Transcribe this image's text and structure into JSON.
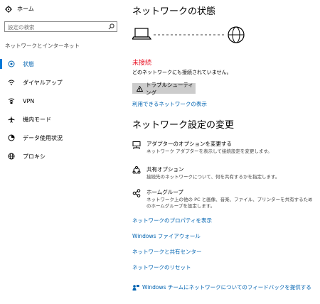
{
  "sidebar": {
    "home": "ホーム",
    "search_placeholder": "設定の検索",
    "section": "ネットワークとインターネット",
    "items": [
      {
        "label": "状態",
        "icon": "globe-status-icon",
        "active": true
      },
      {
        "label": "ダイヤルアップ",
        "icon": "dialup-icon"
      },
      {
        "label": "VPN",
        "icon": "vpn-icon"
      },
      {
        "label": "機内モード",
        "icon": "airplane-icon"
      },
      {
        "label": "データ使用状況",
        "icon": "data-usage-icon"
      },
      {
        "label": "プロキシ",
        "icon": "globe-icon"
      }
    ]
  },
  "main": {
    "title": "ネットワークの状態",
    "status": "未接続",
    "status_desc": "どのネットワークにも接続されていません。",
    "troubleshoot": "トラブルシューティング",
    "available_link": "利用できるネットワークの表示",
    "section_title": "ネットワーク設定の変更",
    "options": [
      {
        "title": "アダプターのオプションを変更する",
        "desc": "ネットワーク アダプターを表示して接続設定を変更します。",
        "icon": "adapter-icon"
      },
      {
        "title": "共有オプション",
        "desc": "接続先のネットワークについて、何を共有するかを指定します。",
        "icon": "sharing-icon"
      },
      {
        "title": "ホームグループ",
        "desc": "ネットワーク上の他の PC と画像、音楽、ファイル、プリンターを共有するためのホームグループを設定します。",
        "icon": "homegroup-icon"
      }
    ],
    "links": [
      "ネットワークのプロパティを表示",
      "Windows ファイアウォール",
      "ネットワークと共有センター",
      "ネットワークのリセット"
    ],
    "feedback": "Windows チームにネットワークについてのフィードバックを提供する"
  },
  "colors": {
    "accent": "#0063b1",
    "error": "#e81123",
    "button": "#cccccc"
  }
}
